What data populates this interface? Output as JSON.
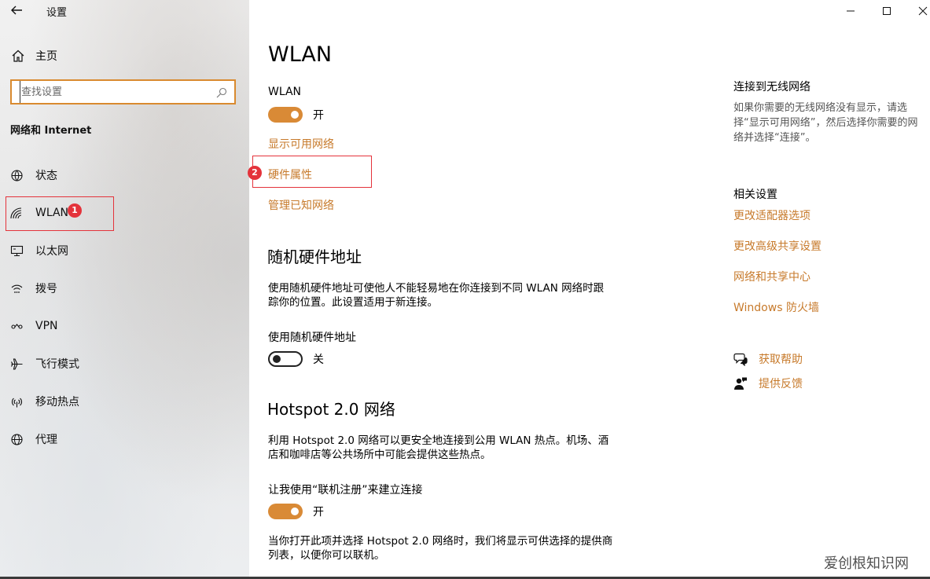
{
  "window": {
    "title": "设置"
  },
  "sidebar": {
    "home_label": "主页",
    "search_placeholder": "查找设置",
    "section_title": "网络和 Internet",
    "items": [
      {
        "label": "状态",
        "icon": "globe-status-icon"
      },
      {
        "label": "WLAN",
        "icon": "wifi-icon"
      },
      {
        "label": "以太网",
        "icon": "ethernet-icon"
      },
      {
        "label": "拨号",
        "icon": "dialup-icon"
      },
      {
        "label": "VPN",
        "icon": "vpn-icon"
      },
      {
        "label": "飞行模式",
        "icon": "airplane-icon"
      },
      {
        "label": "移动热点",
        "icon": "hotspot-icon"
      },
      {
        "label": "代理",
        "icon": "globe-icon"
      }
    ]
  },
  "annotations": {
    "badge1": "1",
    "badge2": "2"
  },
  "main": {
    "title": "WLAN",
    "wlan_label": "WLAN",
    "wlan_state": "开",
    "links": [
      "显示可用网络",
      "硬件属性",
      "管理已知网络"
    ],
    "random_mac": {
      "heading": "随机硬件地址",
      "desc_line1": "使用随机硬件地址可使他人不能轻易地在你连接到不同 WLAN 网络时跟",
      "desc_line2": "踪你的位置。此设置适用于新连接。",
      "toggle_label": "使用随机硬件地址",
      "toggle_state": "关"
    },
    "hotspot": {
      "heading": "Hotspot 2.0 网络",
      "desc_line1": "利用 Hotspot 2.0 网络可以更安全地连接到公用 WLAN 热点。机场、酒",
      "desc_line2": "店和咖啡店等公共场所中可能会提供这些热点。",
      "toggle_label": "让我使用“联机注册”来建立连接",
      "toggle_state": "开",
      "footer_line1": "当你打开此项并选择 Hotspot 2.0 网络时，我们将显示可供选择的提供商",
      "footer_line2": "列表，以便你可以联机。"
    }
  },
  "right": {
    "connect_title": "连接到无线网络",
    "connect_desc": "如果你需要的无线网络没有显示，请选择“显示可用网络”，然后选择你需要的网络并选择“连接”。",
    "related_title": "相关设置",
    "related_links": [
      "更改适配器选项",
      "更改高级共享设置",
      "网络和共享中心",
      "Windows 防火墙"
    ],
    "help_label": "获取帮助",
    "feedback_label": "提供反馈"
  },
  "watermark": "爱创根知识网",
  "colors": {
    "accent": "#c77a2b",
    "toggle_on": "#d98a36",
    "annotation": "#e4333b",
    "search_border": "#d98a2f"
  }
}
